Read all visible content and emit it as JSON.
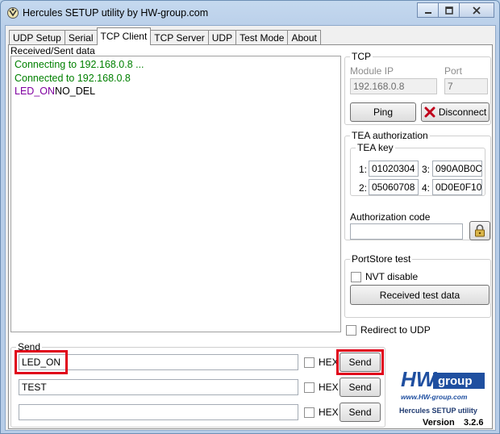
{
  "window": {
    "title": "Hercules SETUP utility by HW-group.com"
  },
  "tabs": [
    "UDP Setup",
    "Serial",
    "TCP Client",
    "TCP Server",
    "UDP",
    "Test Mode",
    "About"
  ],
  "received": {
    "label": "Received/Sent data",
    "line1": "Connecting to 192.168.0.8 ...",
    "line2": "Connected to 192.168.0.8",
    "line3_purple": "LED_ON",
    "line3_black": "NO_DEL"
  },
  "tcp": {
    "legend": "TCP",
    "module_ip_label": "Module IP",
    "module_ip": "192.168.0.8",
    "port_label": "Port",
    "port": "7",
    "ping_label": "Ping",
    "disconnect_label": "Disconnect"
  },
  "tea": {
    "legend": "TEA authorization",
    "key_legend": "TEA key",
    "k1_label": "1:",
    "k1": "01020304",
    "k2_label": "2:",
    "k2": "05060708",
    "k3_label": "3:",
    "k3": "090A0B0C",
    "k4_label": "4:",
    "k4": "0D0E0F10",
    "auth_code_label": "Authorization code",
    "auth_code": ""
  },
  "portstore": {
    "legend": "PortStore test",
    "nvt_label": "NVT disable",
    "received_test_label": "Received test data"
  },
  "redirect": {
    "label": "Redirect to UDP"
  },
  "send": {
    "legend": "Send",
    "rows": [
      {
        "value": "LED_ON",
        "hex_label": "HEX",
        "button": "Send"
      },
      {
        "value": "TEST",
        "hex_label": "HEX",
        "button": "Send"
      },
      {
        "value": "",
        "hex_label": "HEX",
        "button": "Send"
      }
    ]
  },
  "logo": {
    "brand_hw": "HW",
    "brand_group": "group",
    "url": "www.HW-group.com",
    "product": "Hercules SETUP utility",
    "version_label": "Version",
    "version": "3.2.6"
  },
  "colors": {
    "received_green": "#008000",
    "received_purple": "#8000a0",
    "highlight_red": "#e0001a",
    "logo_blue": "#1f4fa0"
  }
}
